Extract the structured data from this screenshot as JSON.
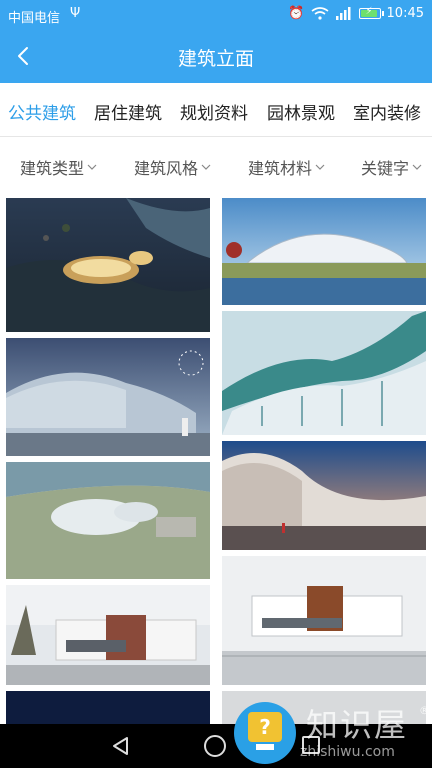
{
  "status_bar": {
    "carrier": "中国电信",
    "usb_icon": "usb-icon",
    "time": "10:45",
    "icons": [
      "alarm-icon",
      "wifi-icon",
      "signal-icon",
      "battery-icon"
    ],
    "battery_level": 0.8
  },
  "header": {
    "title": "建筑立面",
    "back_icon": "back-arrow-icon"
  },
  "tabs": {
    "items": [
      {
        "label": "公共建筑",
        "active": true
      },
      {
        "label": "居住建筑",
        "active": false
      },
      {
        "label": "规划资料",
        "active": false
      },
      {
        "label": "园林景观",
        "active": false
      },
      {
        "label": "室内装修",
        "active": false
      }
    ]
  },
  "filters": {
    "items": [
      {
        "label": "建筑类型"
      },
      {
        "label": "建筑风格"
      },
      {
        "label": "建筑材料"
      },
      {
        "label": "关键字"
      }
    ]
  },
  "grid": {
    "left_column": [
      {
        "subject": "night aerial of stadium by lake"
      },
      {
        "subject": "faceted dome at dusk with fireworks"
      },
      {
        "subject": "aerial of organic pavilion by river"
      },
      {
        "subject": "white museum with trees"
      },
      {
        "subject": "night scene (partial)"
      }
    ],
    "right_column": [
      {
        "subject": "white lattice building by water"
      },
      {
        "subject": "green wave canopy structure"
      },
      {
        "subject": "perforated wave facade at sunset"
      },
      {
        "subject": "white cultural center with brown block"
      },
      {
        "subject": "partial building"
      }
    ]
  },
  "navbar": {
    "icons": [
      "nav-back-icon",
      "nav-home-icon",
      "nav-recent-icon"
    ]
  },
  "watermark": {
    "text": "知识屋",
    "reg_mark": "®",
    "url": "zhishiwu.com",
    "badge_mark": "?"
  },
  "colors": {
    "primary": "#3aa6f0",
    "active_tab": "#2d9ee8"
  }
}
